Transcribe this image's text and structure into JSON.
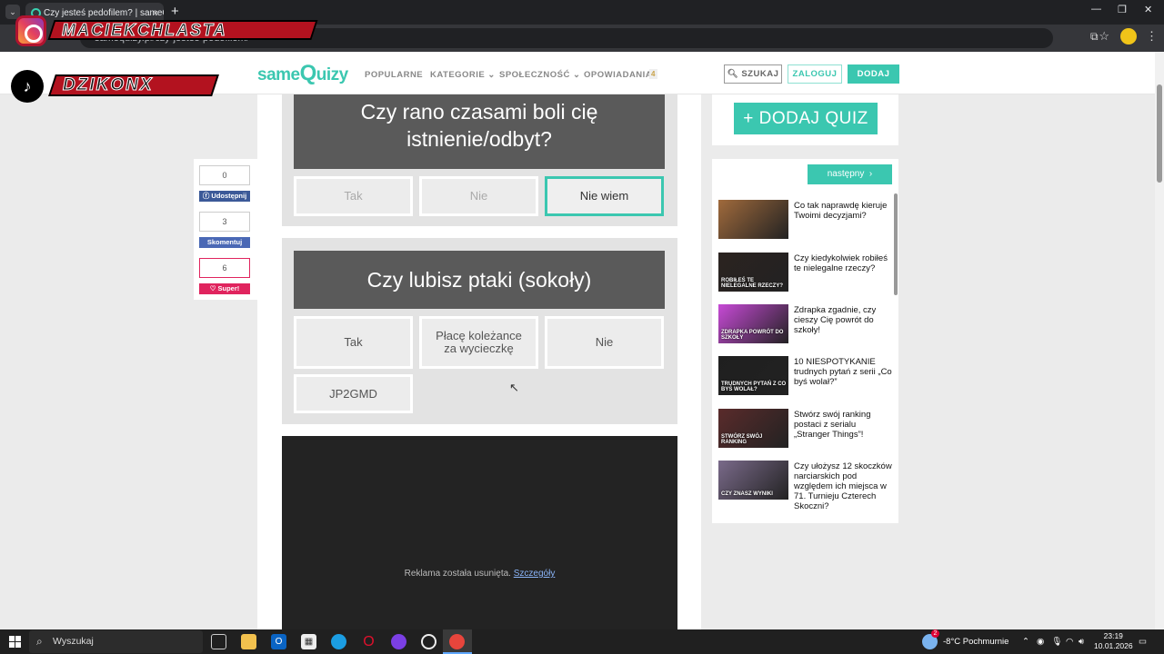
{
  "browser": {
    "tab_title": "Czy jesteś pedofilem? | sameQ",
    "url": "samequizy.pl/czy-jestes-pedofilem/",
    "tab_close": "×",
    "new_tab": "+",
    "tab_menu": "⌄",
    "win_min": "—",
    "win_max": "❐",
    "win_close": "✕"
  },
  "overlay": {
    "instagram_handle": "MACIEKCHLASTA",
    "tiktok_handle": "DZIKONX"
  },
  "site": {
    "logo_same": "same",
    "logo_q": "Q",
    "logo_uizy": "uizy",
    "nav": [
      "POPULARNE",
      "KATEGORIE ⌄",
      "SPOŁECZNOŚĆ ⌄",
      "OPOWIADANIA"
    ],
    "opowiadania_badge": "4",
    "search_btn": "SZUKAJ",
    "login_btn": "ZALOGUJ",
    "add_btn": "DODAJ"
  },
  "quiz": {
    "q1": {
      "title": "Czy rano czasami boli cię istnienie/odbyt?",
      "answers": [
        "Tak",
        "Nie",
        "Nie wiem"
      ],
      "selected": "Nie wiem"
    },
    "q2": {
      "title": "Czy lubisz ptaki (sokoły)",
      "answers": [
        "Tak",
        "Płacę koleżance za wycieczkę",
        "Nie",
        "JP2GMD"
      ]
    },
    "ad_text": "Reklama została usunięta.",
    "ad_link": "Szczegóły"
  },
  "share": {
    "count_share": "0",
    "label_share": "Udostępnij",
    "count_comment": "3",
    "label_comment": "Skomentuj",
    "count_super": "6",
    "label_super": "Super!"
  },
  "sidebar": {
    "add_quiz": "+ DODAJ QUIZ",
    "next_label": "następny",
    "items": [
      {
        "title": "Co tak naprawdę kieruje Twoimi decyzjami?",
        "thumb_text": "",
        "thumb_color": "#a06a3c"
      },
      {
        "title": "Czy kiedykolwiek robiłeś te nielegalne rzeczy?",
        "thumb_text": "ROBIŁEŚ TE NIELEGALNE RZECZY?",
        "thumb_color": "#2b2320"
      },
      {
        "title": "Zdrapka zgadnie, czy cieszy Cię powrót do szkoły!",
        "thumb_text": "ZDRAPKA POWRÓT DO SZKOŁY",
        "thumb_color": "#c74ad6"
      },
      {
        "title": "10 NIESPOTYKANIE trudnych pytań z serii „Co byś wolał?”",
        "thumb_text": "TRUDNYCH PYTAŃ Z CO BYŚ WOLAŁ?",
        "thumb_color": "#1f1f1f"
      },
      {
        "title": "Stwórz swój ranking postaci z serialu „Stranger Things”!",
        "thumb_text": "STWÓRZ SWÓJ RANKING",
        "thumb_color": "#5a2b2b"
      },
      {
        "title": "Czy ułożysz 12 skoczków narciarskich pod względem ich miejsca w 71. Turnieju Czterech Skoczni?",
        "thumb_text": "CZY ZNASZ WYNIKI",
        "thumb_color": "#7a6a8a"
      }
    ]
  },
  "taskbar": {
    "search_placeholder": "Wyszukaj",
    "weather": "-8°C  Pochmurnie",
    "weather_badge": "2",
    "time": "23:19",
    "date": "10.01.2026"
  },
  "colors": {
    "accent": "#3bc7b0",
    "question_bg": "#5a5a5a",
    "facebook": "#3b5998",
    "comment": "#4a68b5",
    "super": "#e0245e"
  }
}
